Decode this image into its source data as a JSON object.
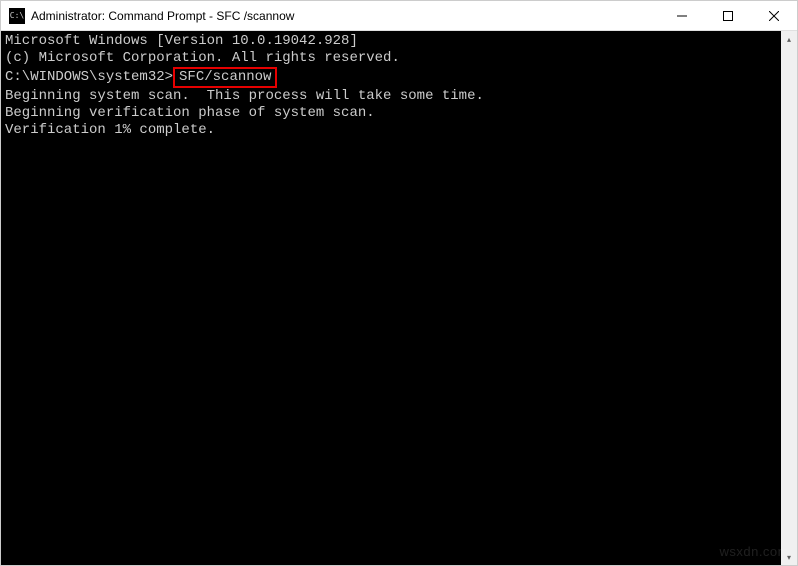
{
  "titlebar": {
    "icon_label": "cmd-icon",
    "title": "Administrator: Command Prompt - SFC /scannow"
  },
  "terminal": {
    "line1": "Microsoft Windows [Version 10.0.19042.928]",
    "line2": "(c) Microsoft Corporation. All rights reserved.",
    "blank1": "",
    "prompt_prefix": "C:\\WINDOWS\\system32>",
    "command": "SFC/scannow",
    "blank2": "",
    "scan1": "Beginning system scan.  This process will take some time.",
    "blank3": "",
    "verify1": "Beginning verification phase of system scan.",
    "verify2": "Verification 1% complete."
  },
  "watermark": "wsxdn.com"
}
